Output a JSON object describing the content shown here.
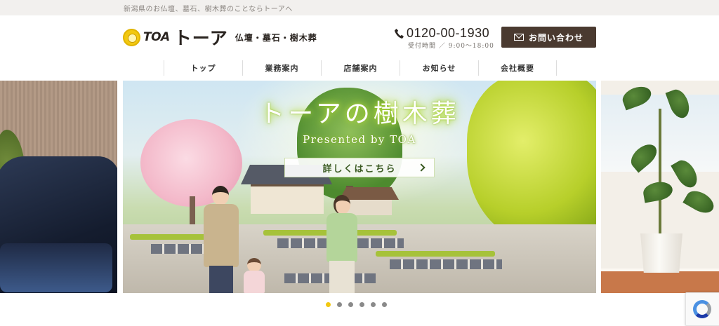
{
  "topbar": {
    "tagline": "新潟県のお仏壇、墓石、樹木葬のことならトーアへ"
  },
  "header": {
    "logo": {
      "mark": "TOA",
      "name": "トーア",
      "subtitle": "仏壇・墓石・樹木葬"
    },
    "phone": {
      "icon": "phone-icon",
      "number": "0120-00-1930",
      "hours": "受付時間 ／ 9:00〜18:00"
    },
    "contact_button": {
      "icon": "mail-icon",
      "label": "お問い合わせ",
      "color": "#4a3a30"
    }
  },
  "nav": {
    "items": [
      {
        "label": "トップ"
      },
      {
        "label": "業務案内"
      },
      {
        "label": "店舗案内"
      },
      {
        "label": "お知らせ"
      },
      {
        "label": "会社概要"
      }
    ]
  },
  "slider": {
    "main": {
      "title": "トーアの樹木葬",
      "subtitle": "Presented by TOA",
      "button_label": "詳しくはこちら",
      "accent_color": "#a8d030"
    },
    "active_index": 0,
    "dot_count": 6,
    "active_dot_color": "#f2c811"
  },
  "recaptcha": {
    "icon": "recaptcha-icon"
  }
}
